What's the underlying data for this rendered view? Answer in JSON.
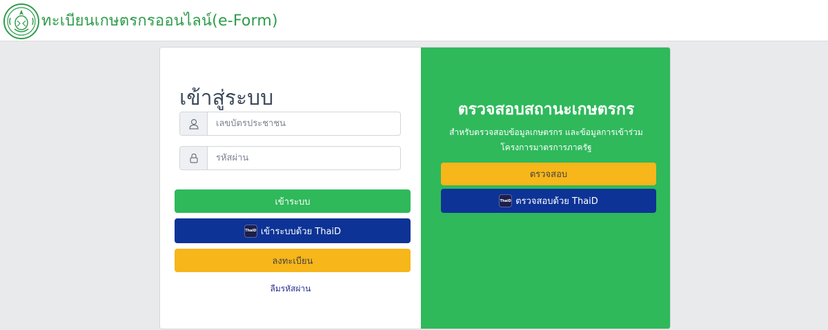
{
  "header": {
    "site_title": "ทะเบียนเกษตรกรออนไลน์(e-Form)",
    "logo_icon": "ministry-seal-icon"
  },
  "login": {
    "title": "เข้าสู่ระบบ",
    "id_placeholder": "เลขบัตรประชาชน",
    "id_icon": "user-icon",
    "password_placeholder": "รหัสผ่าน",
    "password_icon": "lock-icon",
    "login_button": "เข้าระบบ",
    "thaid_login_button": "เข้าระบบด้วย ThaiD",
    "register_button": "ลงทะเบียน",
    "forgot_password": "ลืมรหัสผ่าน"
  },
  "check": {
    "title": "ตรวจสอบสถานะเกษตรกร",
    "description": "สำหรับตรวจสอบข้อมูลเกษตรกร และข้อมูลการเข้าร่วมโครงการมาตรการภาครัฐ",
    "check_button": "ตรวจสอบ",
    "thaid_check_button": "ตรวจสอบด้วย ThaiD"
  },
  "thaid_badge_text": "ThaiD",
  "colors": {
    "green": "#2fb95b",
    "navy": "#0d3396",
    "yellow": "#f7b619",
    "title_green": "#2e9c4a"
  }
}
